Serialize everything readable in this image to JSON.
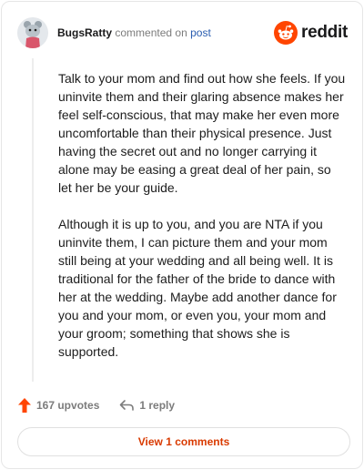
{
  "header": {
    "username": "BugsRatty",
    "action_text": "commented on",
    "post_link": "post",
    "logo_text": "reddit"
  },
  "comment": {
    "paragraphs": [
      "Talk to your mom and find out how she feels. If you uninvite them and their glaring absence makes her feel self-conscious, that may make her even more uncomfortable than their physical presence. Just having the secret out and no longer carrying it alone may be easing a great deal of her pain, so let her be your guide.",
      "Although it is up to you, and you are NTA if you uninvite them, I can picture them and your mom still being at your wedding and all being well. It is traditional for the father of the bride to dance with her at the wedding. Maybe add another dance for you and your mom, or even you, your mom and your groom; something that shows she is supported."
    ]
  },
  "actions": {
    "upvotes": "167 upvotes",
    "replies": "1 reply"
  },
  "footer": {
    "view_comments": "View 1 comments"
  },
  "colors": {
    "brand": "#ff4500",
    "upvote": "#ff4500",
    "link": "#2a5db0",
    "view_button_text": "#d93a00"
  },
  "icons": {
    "avatar": "avatar-icon",
    "logo": "reddit-snoo-icon",
    "upvote": "upvote-arrow-icon",
    "reply": "reply-arrow-icon"
  }
}
